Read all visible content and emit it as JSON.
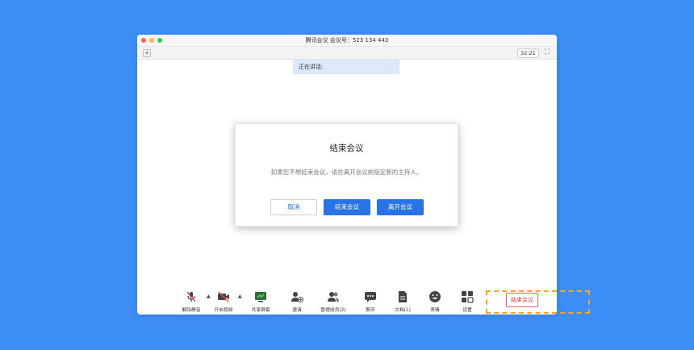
{
  "window": {
    "title": "腾讯会议 会议号：523 134 443"
  },
  "toolbar": {
    "timer": "32:21"
  },
  "speaking": {
    "label": "正在讲话:"
  },
  "dialog": {
    "title": "结束会议",
    "message": "如果您不想结束会议，请在离开会议前指定新的主持人。",
    "cancel_label": "取消",
    "end_label": "结束会议",
    "leave_label": "离开会议"
  },
  "bottom_toolbar": {
    "unmute_label": "解除静音",
    "start_video_label": "开启视频",
    "share_screen_label": "共享屏幕",
    "invite_label": "邀请",
    "manage_members_label": "管理成员(2)",
    "chat_label": "聊天",
    "docs_label": "文档(1)",
    "emoji_label": "表情",
    "settings_label": "设置",
    "end_meeting_label": "结束会议"
  },
  "colors": {
    "background": "#3e8ef7",
    "primary": "#2a72e8",
    "danger": "#e84545",
    "highlight": "#f5a623"
  }
}
